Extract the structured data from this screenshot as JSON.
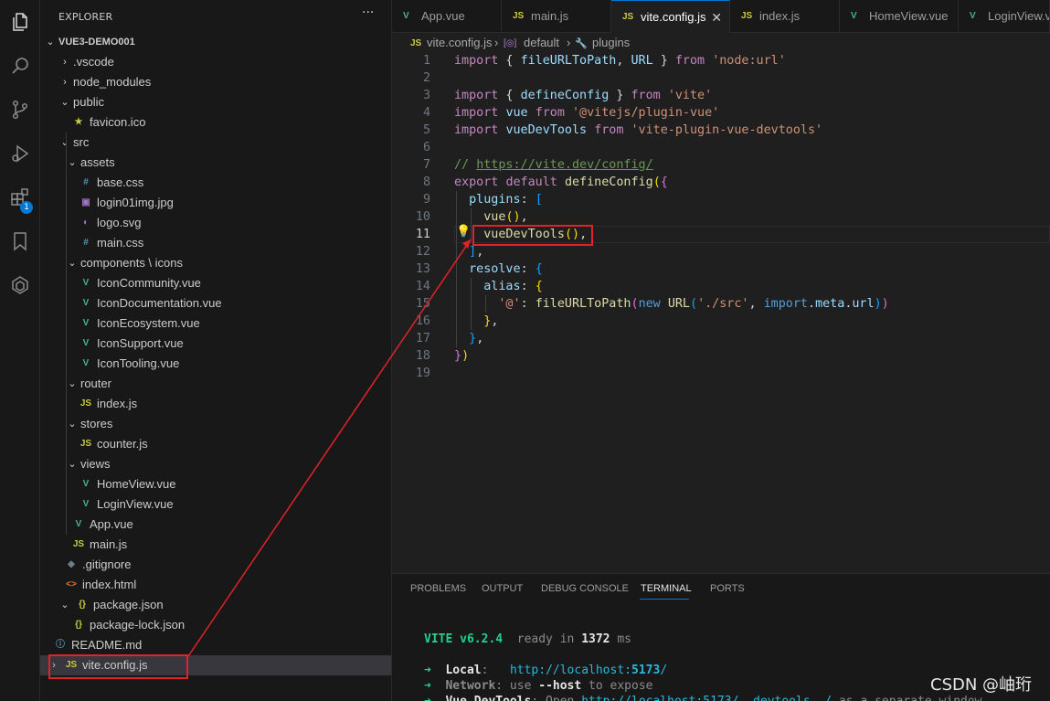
{
  "explorer": {
    "title": "EXPLORER",
    "more": "···",
    "root": "VUE3-DEMO001",
    "items": [
      {
        "label": ".vscode",
        "kind": "folder",
        "icon": "",
        "twisty": "›",
        "depth": 1
      },
      {
        "label": "node_modules",
        "kind": "folder",
        "icon": "",
        "twisty": "›",
        "depth": 1
      },
      {
        "label": "public",
        "kind": "folder",
        "icon": "",
        "twisty": "⌄",
        "depth": 1
      },
      {
        "label": "favicon.ico",
        "kind": "star",
        "icon": "★",
        "twisty": "",
        "depth": 2
      },
      {
        "label": "src",
        "kind": "folder",
        "icon": "",
        "twisty": "⌄",
        "depth": 1
      },
      {
        "label": "assets",
        "kind": "folder",
        "icon": "",
        "twisty": "⌄",
        "depth": 2
      },
      {
        "label": "base.css",
        "kind": "css",
        "icon": "#",
        "twisty": "",
        "depth": 3
      },
      {
        "label": "login01img.jpg",
        "kind": "img",
        "icon": "▣",
        "twisty": "",
        "depth": 3
      },
      {
        "label": "logo.svg",
        "kind": "svg",
        "icon": "◐",
        "twisty": "",
        "depth": 3
      },
      {
        "label": "main.css",
        "kind": "css",
        "icon": "#",
        "twisty": "",
        "depth": 3
      },
      {
        "label": "components \\ icons",
        "kind": "folder",
        "icon": "",
        "twisty": "⌄",
        "depth": 2
      },
      {
        "label": "IconCommunity.vue",
        "kind": "vue",
        "icon": "V",
        "twisty": "",
        "depth": 3
      },
      {
        "label": "IconDocumentation.vue",
        "kind": "vue",
        "icon": "V",
        "twisty": "",
        "depth": 3
      },
      {
        "label": "IconEcosystem.vue",
        "kind": "vue",
        "icon": "V",
        "twisty": "",
        "depth": 3
      },
      {
        "label": "IconSupport.vue",
        "kind": "vue",
        "icon": "V",
        "twisty": "",
        "depth": 3
      },
      {
        "label": "IconTooling.vue",
        "kind": "vue",
        "icon": "V",
        "twisty": "",
        "depth": 3
      },
      {
        "label": "router",
        "kind": "folder",
        "icon": "",
        "twisty": "⌄",
        "depth": 2
      },
      {
        "label": "index.js",
        "kind": "js",
        "icon": "JS",
        "twisty": "",
        "depth": 3
      },
      {
        "label": "stores",
        "kind": "folder",
        "icon": "",
        "twisty": "⌄",
        "depth": 2
      },
      {
        "label": "counter.js",
        "kind": "js",
        "icon": "JS",
        "twisty": "",
        "depth": 3
      },
      {
        "label": "views",
        "kind": "folder",
        "icon": "",
        "twisty": "⌄",
        "depth": 2
      },
      {
        "label": "HomeView.vue",
        "kind": "vue",
        "icon": "V",
        "twisty": "",
        "depth": 3
      },
      {
        "label": "LoginView.vue",
        "kind": "vue",
        "icon": "V",
        "twisty": "",
        "depth": 3
      },
      {
        "label": "App.vue",
        "kind": "vue",
        "icon": "V",
        "twisty": "",
        "depth": 2
      },
      {
        "label": "main.js",
        "kind": "js",
        "icon": "JS",
        "twisty": "",
        "depth": 2
      },
      {
        "label": ".gitignore",
        "kind": "git",
        "icon": "◆",
        "twisty": "",
        "depth": 1
      },
      {
        "label": "index.html",
        "kind": "html",
        "icon": "<>",
        "twisty": "",
        "depth": 1
      },
      {
        "label": "package.json",
        "kind": "json",
        "icon": "{}",
        "twisty": "⌄",
        "depth": 1
      },
      {
        "label": "package-lock.json",
        "kind": "json",
        "icon": "{}",
        "twisty": "",
        "depth": 2
      },
      {
        "label": "README.md",
        "kind": "info",
        "icon": "ⓘ",
        "twisty": "",
        "depth": 0
      },
      {
        "label": "vite.config.js",
        "kind": "js",
        "icon": "JS",
        "twisty": "›",
        "depth": 0,
        "selected": true
      }
    ]
  },
  "activity_bar": {
    "icons": [
      "files-icon",
      "search-icon",
      "source-control-icon",
      "run-debug-icon",
      "extensions-icon",
      "bookmark-icon",
      "vue-devtools-icon"
    ],
    "extensions_badge": "1"
  },
  "tabs": [
    {
      "label": "App.vue",
      "icon": "V",
      "kind": "vue"
    },
    {
      "label": "main.js",
      "icon": "JS",
      "kind": "js"
    },
    {
      "label": "vite.config.js",
      "icon": "JS",
      "kind": "js",
      "active": true,
      "close": "✕"
    },
    {
      "label": "index.js",
      "icon": "JS",
      "kind": "js"
    },
    {
      "label": "HomeView.vue",
      "icon": "V",
      "kind": "vue"
    },
    {
      "label": "LoginView.vue",
      "icon": "V",
      "kind": "vue"
    }
  ],
  "breadcrumb": {
    "file_icon": "JS",
    "file": "vite.config.js",
    "sep1": "›",
    "symbol1_icon": "[◎]",
    "symbol1": "default",
    "sep2": "›",
    "symbol2_icon": "🔧",
    "symbol2": "plugins"
  },
  "editor": {
    "current_line": 11,
    "lightbulb": "💡",
    "lines": [
      [
        [
          "kw2",
          "import"
        ],
        [
          "pn",
          " { "
        ],
        [
          "vr",
          "fileURLToPath"
        ],
        [
          "pn",
          ", "
        ],
        [
          "vr",
          "URL"
        ],
        [
          "pn",
          " } "
        ],
        [
          "kw2",
          "from"
        ],
        [
          "pn",
          " "
        ],
        [
          "st",
          "'node:url'"
        ]
      ],
      [],
      [
        [
          "kw2",
          "import"
        ],
        [
          "pn",
          " { "
        ],
        [
          "vr",
          "defineConfig"
        ],
        [
          "pn",
          " } "
        ],
        [
          "kw2",
          "from"
        ],
        [
          "pn",
          " "
        ],
        [
          "st",
          "'vite'"
        ]
      ],
      [
        [
          "kw2",
          "import"
        ],
        [
          "pn",
          " "
        ],
        [
          "vr",
          "vue"
        ],
        [
          "pn",
          " "
        ],
        [
          "kw2",
          "from"
        ],
        [
          "pn",
          " "
        ],
        [
          "st",
          "'@vitejs/plugin-vue'"
        ]
      ],
      [
        [
          "kw2",
          "import"
        ],
        [
          "pn",
          " "
        ],
        [
          "vr",
          "vueDevTools"
        ],
        [
          "pn",
          " "
        ],
        [
          "kw2",
          "from"
        ],
        [
          "pn",
          " "
        ],
        [
          "st",
          "'vite-plugin-vue-devtools'"
        ]
      ],
      [],
      [
        [
          "cm",
          "// "
        ],
        [
          "cmu",
          "https://vite.dev/config/"
        ]
      ],
      [
        [
          "kw2",
          "export"
        ],
        [
          "pn",
          " "
        ],
        [
          "kw2",
          "default"
        ],
        [
          "pn",
          " "
        ],
        [
          "fn",
          "defineConfig"
        ],
        [
          "br1",
          "("
        ],
        [
          "br2",
          "{"
        ]
      ],
      [
        [
          "pn",
          "  "
        ],
        [
          "vr",
          "plugins"
        ],
        [
          "pn",
          ": "
        ],
        [
          "br3",
          "["
        ]
      ],
      [
        [
          "pn",
          "    "
        ],
        [
          "fn",
          "vue"
        ],
        [
          "br1",
          "()"
        ],
        [
          "pn",
          ","
        ]
      ],
      [
        [
          "pn",
          "    "
        ],
        [
          "fn",
          "vueDevTools"
        ],
        [
          "br1",
          "()"
        ],
        [
          "pn",
          ","
        ]
      ],
      [
        [
          "pn",
          "  "
        ],
        [
          "br3",
          "]"
        ],
        [
          "pn",
          ","
        ]
      ],
      [
        [
          "pn",
          "  "
        ],
        [
          "vr",
          "resolve"
        ],
        [
          "pn",
          ": "
        ],
        [
          "br3",
          "{"
        ]
      ],
      [
        [
          "pn",
          "    "
        ],
        [
          "vr",
          "alias"
        ],
        [
          "pn",
          ": "
        ],
        [
          "br1",
          "{"
        ]
      ],
      [
        [
          "pn",
          "      "
        ],
        [
          "st",
          "'@'"
        ],
        [
          "pn",
          ": "
        ],
        [
          "fn",
          "fileURLToPath"
        ],
        [
          "br2",
          "("
        ],
        [
          "kw",
          "new"
        ],
        [
          "pn",
          " "
        ],
        [
          "fn",
          "URL"
        ],
        [
          "br3",
          "("
        ],
        [
          "st",
          "'./src'"
        ],
        [
          "pn",
          ", "
        ],
        [
          "kw",
          "import"
        ],
        [
          "pn",
          "."
        ],
        [
          "vr",
          "meta"
        ],
        [
          "pn",
          "."
        ],
        [
          "vr",
          "url"
        ],
        [
          "br3",
          ")"
        ],
        [
          "br2",
          ")"
        ]
      ],
      [
        [
          "pn",
          "    "
        ],
        [
          "br1",
          "}"
        ],
        [
          "pn",
          ","
        ]
      ],
      [
        [
          "pn",
          "  "
        ],
        [
          "br3",
          "}"
        ],
        [
          "pn",
          ","
        ]
      ],
      [
        [
          "br2",
          "}"
        ],
        [
          "br1",
          ")"
        ]
      ],
      []
    ]
  },
  "panel": {
    "tabs": [
      "PROBLEMS",
      "OUTPUT",
      "DEBUG CONSOLE",
      "TERMINAL",
      "PORTS"
    ],
    "active_tab": "TERMINAL",
    "terminal": [
      [
        [
          "vite",
          "VITE v6.2.4"
        ],
        [
          "dim",
          "  ready in "
        ],
        [
          "bold",
          "1372"
        ],
        [
          "dim",
          " ms"
        ]
      ],
      [],
      [
        [
          "green",
          "➜  "
        ],
        [
          "bold",
          "Local"
        ],
        [
          "dim",
          ":   "
        ],
        [
          "cyan",
          "http://localhost:"
        ],
        [
          "cyanb",
          "5173"
        ],
        [
          "cyan",
          "/"
        ]
      ],
      [
        [
          "green",
          "➜  "
        ],
        [
          "dimb",
          "Network"
        ],
        [
          "dim",
          ": use "
        ],
        [
          "bold",
          "--host"
        ],
        [
          "dim",
          " to expose"
        ]
      ],
      [
        [
          "green",
          "➜  "
        ],
        [
          "bold",
          "Vue DevTools"
        ],
        [
          "dim",
          ": Open "
        ],
        [
          "cyan",
          "http://localhost:5173/__devtools__/"
        ],
        [
          "dim",
          " as a separate window"
        ]
      ]
    ]
  },
  "watermark": "CSDN @岫珩",
  "colors": {
    "annotation": "#e0222a",
    "accent": "#0078d4",
    "vue_green": "#41b883",
    "js_yellow": "#cbcb41"
  }
}
